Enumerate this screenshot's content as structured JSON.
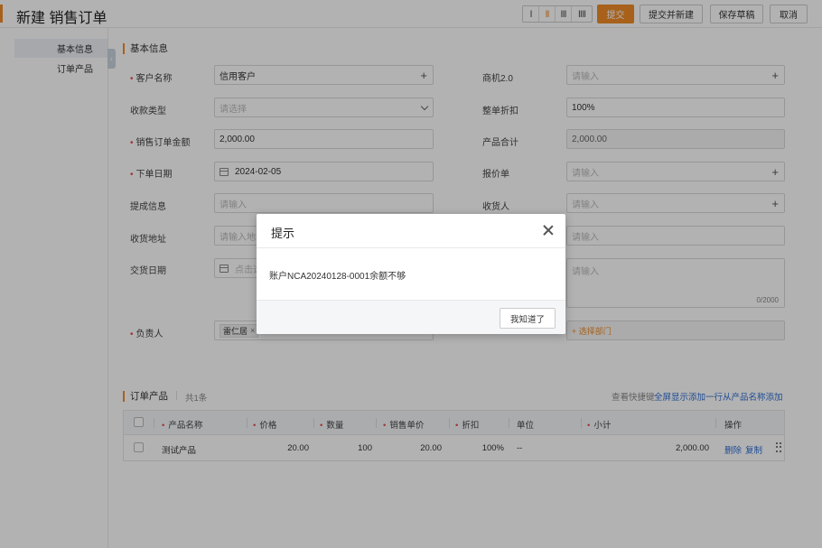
{
  "header": {
    "title": "新建 销售订单",
    "layout_options": [
      "I",
      "II",
      "III",
      "IIII"
    ],
    "submit_label": "提交",
    "submit_new_label": "提交并新建",
    "save_draft_label": "保存草稿",
    "cancel_label": "取消",
    "accent_color": "#f08c28"
  },
  "sidebar": {
    "items": [
      {
        "label": "基本信息",
        "active": true
      },
      {
        "label": "订单产品",
        "active": false
      }
    ]
  },
  "basic": {
    "section_title": "基本信息",
    "customer": {
      "label": "客户名称",
      "value": "信用客户"
    },
    "opportunity": {
      "label": "商机2.0",
      "placeholder": "请输入"
    },
    "payment_type": {
      "label": "收款类型",
      "placeholder": "请选择"
    },
    "discount": {
      "label": "整单折扣",
      "value": "100%"
    },
    "order_amount": {
      "label": "销售订单金额",
      "value": "2,000.00"
    },
    "product_total": {
      "label": "产品合计",
      "value": "2,000.00"
    },
    "order_date": {
      "label": "下单日期",
      "value": "2024-02-05"
    },
    "quote": {
      "label": "报价单",
      "placeholder": "请输入"
    },
    "commission": {
      "label": "提成信息",
      "placeholder": "请输入"
    },
    "receiver": {
      "label": "收货人",
      "placeholder": "请输入"
    },
    "address": {
      "label": "收货地址",
      "placeholder": "请输入地址",
      "right_placeholder": "请输入"
    },
    "delivery_date": {
      "label": "交货日期",
      "placeholder": "点击选",
      "remark_placeholder": "请输入",
      "counter": "0/2000"
    },
    "owner": {
      "label": "负责人",
      "tag": "雷仁居"
    },
    "department": {
      "placeholder": "+ 选择部门"
    }
  },
  "products": {
    "section_title": "订单产品",
    "count": "共1条",
    "shortcut": "查看快捷键",
    "fullscreen": "全屏显示",
    "add_row": "添加一行",
    "add_from_name": "从产品名称添加",
    "columns": [
      "产品名称",
      "价格",
      "数量",
      "销售单价",
      "折扣",
      "单位",
      "小计",
      "操作"
    ],
    "row": {
      "name": "测试产品",
      "price": "20.00",
      "qty": "100",
      "unit_price": "20.00",
      "discount": "100%",
      "unit": "--",
      "subtotal": "2,000.00",
      "delete": "删除",
      "copy": "复制"
    }
  },
  "modal": {
    "title": "提示",
    "message": "账户NCA20240128-0001余额不够",
    "ok_label": "我知道了"
  }
}
